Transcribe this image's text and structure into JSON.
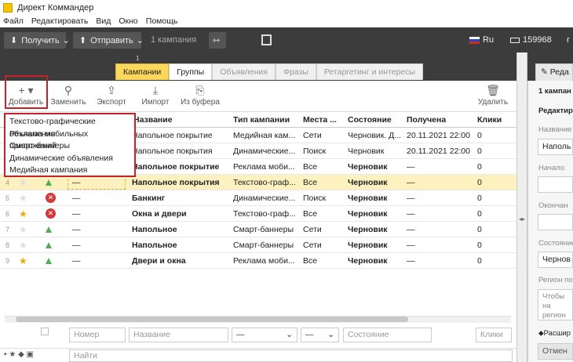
{
  "window": {
    "title": "Директ Коммандер"
  },
  "menu": [
    "Файл",
    "Редактировать",
    "Вид",
    "Окно",
    "Помощь"
  ],
  "darkbar": {
    "get_label": "Получить",
    "send_label": "Отправить",
    "campaign_count": "1 кампания",
    "lang": "Ru",
    "balance": "159968",
    "user_partial": "r"
  },
  "tabs": [
    "Кампании",
    "Группы",
    "Объявления",
    "Фразы",
    "Ретаргетинг и интересы"
  ],
  "tab_badge": "1",
  "toolbar": {
    "add": "Добавить",
    "replace": "Заменить",
    "export": "Экспорт",
    "import": "Импорт",
    "from_buffer": "Из буфера",
    "delete": "Удалить"
  },
  "dropdown": [
    "Текстово-графические объявления",
    "Реклама мобильных приложений",
    "Смарт-баннеры",
    "Динамические объявления",
    "Медийная кампания"
  ],
  "table": {
    "headers": [
      "Название",
      "Тип кампании",
      "Места ...",
      "Состояние",
      "Получена",
      "Клики"
    ],
    "rows": [
      {
        "n": "1",
        "star": false,
        "icon": "tri",
        "num": "",
        "name": "Напольное покрытие",
        "type": "Медийная кам...",
        "places": "Сети",
        "state": "Черновик. Д...",
        "received": "20.11.2021 22:00",
        "clicks": "0",
        "bold": false
      },
      {
        "n": "2",
        "star": false,
        "icon": "tri",
        "num": "",
        "name": "Напольное покрытия",
        "type": "Динамические...",
        "places": "Поиск",
        "state": "Черновик",
        "received": "20.11.2021 22:00",
        "clicks": "0",
        "bold": false
      },
      {
        "n": "3",
        "star": false,
        "icon": "tri",
        "num": "",
        "name": "Напольное покрытие",
        "type": "Реклама моби...",
        "places": "Все",
        "state": "Черновик",
        "received": "—",
        "clicks": "0",
        "bold": true
      },
      {
        "n": "4",
        "star": false,
        "icon": "tri",
        "num": "—",
        "name": "Напольное покрытия",
        "type": "Текстово-граф...",
        "places": "Все",
        "state": "Черновик",
        "received": "—",
        "clicks": "0",
        "bold": true
      },
      {
        "n": "5",
        "star": false,
        "icon": "stop",
        "num": "—",
        "name": "Банкинг",
        "type": "Динамические...",
        "places": "Поиск",
        "state": "Черновик",
        "received": "—",
        "clicks": "0",
        "bold": true
      },
      {
        "n": "6",
        "star": true,
        "icon": "stop",
        "num": "—",
        "name": "Окна и двери",
        "type": "Текстово-граф...",
        "places": "Все",
        "state": "Черновик",
        "received": "—",
        "clicks": "0",
        "bold": true
      },
      {
        "n": "7",
        "star": false,
        "icon": "tri",
        "num": "—",
        "name": "Напольное",
        "type": "Смарт-баннеры",
        "places": "Сети",
        "state": "Черновик",
        "received": "—",
        "clicks": "0",
        "bold": true
      },
      {
        "n": "8",
        "star": false,
        "icon": "tri",
        "num": "—",
        "name": "Напольное",
        "type": "Смарт-баннеры",
        "places": "Сети",
        "state": "Черновик",
        "received": "—",
        "clicks": "0",
        "bold": true
      },
      {
        "n": "9",
        "star": true,
        "icon": "tri",
        "num": "—",
        "name": "Двери и окна",
        "type": "Реклама моби...",
        "places": "Все",
        "state": "Черновик",
        "received": "—",
        "clicks": "0",
        "bold": true
      }
    ]
  },
  "filters": {
    "number_ph": "Номер",
    "name_ph": "Название",
    "type_val": "—",
    "places_val": "—",
    "state_ph": "Состояние",
    "clicks_ph": "Клики"
  },
  "bottom": {
    "find_ph": "Найти"
  },
  "right": {
    "tab": "Реда",
    "count": "1 кампан",
    "edit": "Редактир",
    "name_lbl": "Название",
    "name_val": "Наполь",
    "start_lbl": "Начало",
    "end_lbl": "Окончан",
    "state_lbl": "Состояние",
    "state_val": "Чернов",
    "region_lbl": "Регион пок",
    "region_hint": "Чтобы на регион пок группу об",
    "ext_lbl": "Расшир",
    "cancel": "Отмен"
  }
}
